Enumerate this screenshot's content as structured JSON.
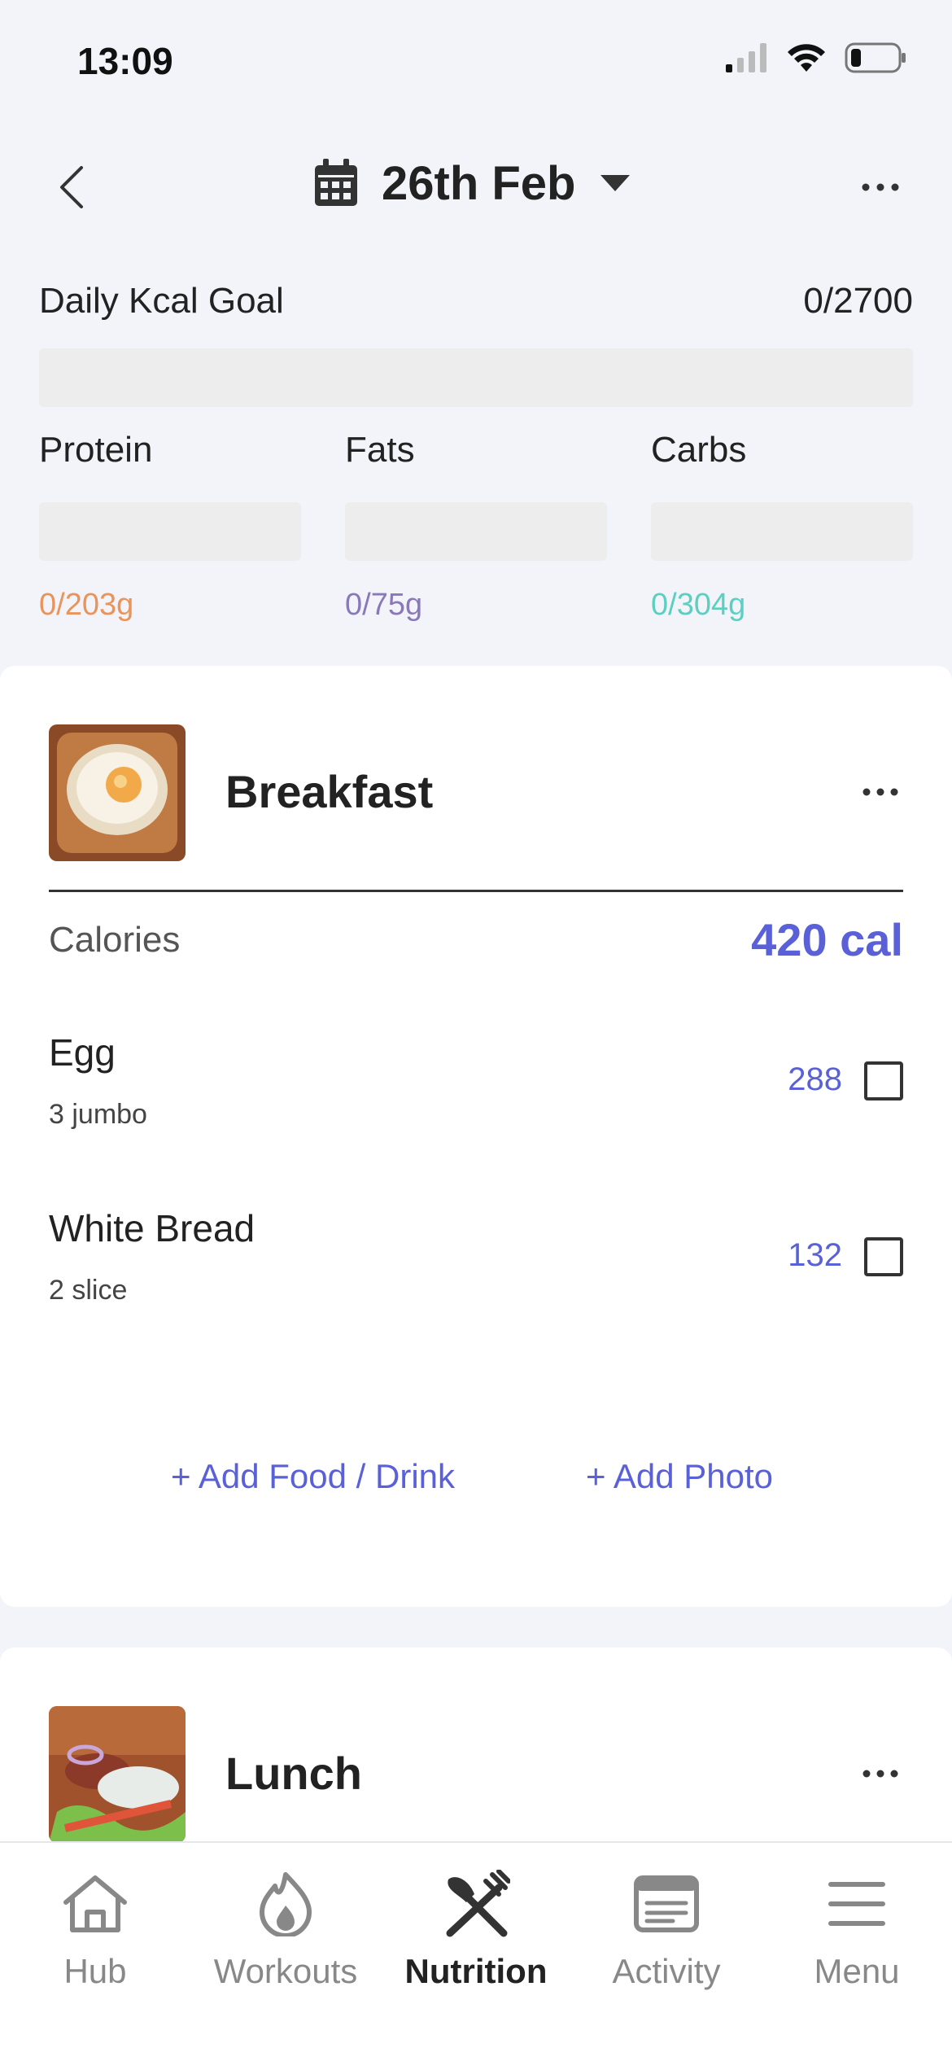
{
  "status": {
    "time": "13:09"
  },
  "header": {
    "date": "26th Feb"
  },
  "goal": {
    "label": "Daily Kcal Goal",
    "value": "0/2700"
  },
  "macros": [
    {
      "name": "Protein",
      "value": "0/203g",
      "color": "#e8945a"
    },
    {
      "name": "Fats",
      "value": "0/75g",
      "color": "#8a79b8"
    },
    {
      "name": "Carbs",
      "value": "0/304g",
      "color": "#5ccfc0"
    }
  ],
  "breakfast": {
    "title": "Breakfast",
    "calories_label": "Calories",
    "calories_total": "420 cal",
    "items": [
      {
        "name": "Egg",
        "qty": "3 jumbo",
        "kcal": "288"
      },
      {
        "name": "White Bread",
        "qty": "2 slice",
        "kcal": "132"
      }
    ],
    "add_food": "+ Add Food / Drink",
    "add_photo": "+ Add Photo"
  },
  "lunch": {
    "title": "Lunch"
  },
  "tabs": [
    {
      "label": "Hub",
      "icon": "home-icon"
    },
    {
      "label": "Workouts",
      "icon": "flame-icon"
    },
    {
      "label": "Nutrition",
      "icon": "fork-knife-icon",
      "active": true
    },
    {
      "label": "Activity",
      "icon": "feed-icon"
    },
    {
      "label": "Menu",
      "icon": "hamburger-icon"
    }
  ],
  "colors": {
    "accent": "#5a60d8"
  }
}
